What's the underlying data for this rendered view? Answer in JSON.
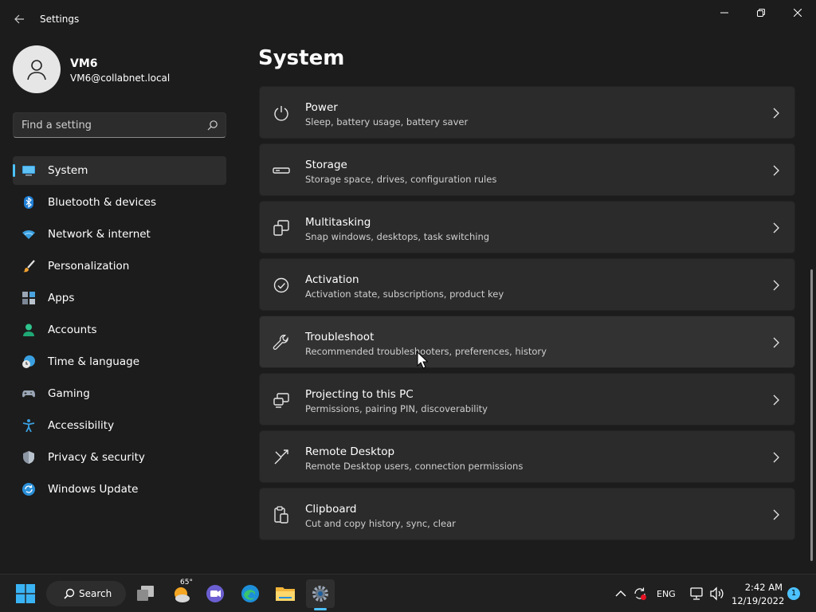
{
  "window": {
    "title": "Settings"
  },
  "user": {
    "name": "VM6",
    "email": "VM6@collabnet.local"
  },
  "search": {
    "placeholder": "Find a setting"
  },
  "nav": [
    {
      "label": "System",
      "icon": "system-icon",
      "active": true
    },
    {
      "label": "Bluetooth & devices",
      "icon": "bluetooth-icon"
    },
    {
      "label": "Network & internet",
      "icon": "wifi-icon"
    },
    {
      "label": "Personalization",
      "icon": "brush-icon"
    },
    {
      "label": "Apps",
      "icon": "apps-icon"
    },
    {
      "label": "Accounts",
      "icon": "accounts-icon"
    },
    {
      "label": "Time & language",
      "icon": "clock-globe-icon"
    },
    {
      "label": "Gaming",
      "icon": "gamepad-icon"
    },
    {
      "label": "Accessibility",
      "icon": "accessibility-icon"
    },
    {
      "label": "Privacy & security",
      "icon": "shield-icon"
    },
    {
      "label": "Windows Update",
      "icon": "update-icon"
    }
  ],
  "main": {
    "title": "System",
    "cards": [
      {
        "title": "Power",
        "subtitle": "Sleep, battery usage, battery saver",
        "icon": "power-icon"
      },
      {
        "title": "Storage",
        "subtitle": "Storage space, drives, configuration rules",
        "icon": "storage-icon"
      },
      {
        "title": "Multitasking",
        "subtitle": "Snap windows, desktops, task switching",
        "icon": "multitasking-icon"
      },
      {
        "title": "Activation",
        "subtitle": "Activation state, subscriptions, product key",
        "icon": "activation-icon"
      },
      {
        "title": "Troubleshoot",
        "subtitle": "Recommended troubleshooters, preferences, history",
        "icon": "wrench-icon",
        "hover": true
      },
      {
        "title": "Projecting to this PC",
        "subtitle": "Permissions, pairing PIN, discoverability",
        "icon": "projecting-icon"
      },
      {
        "title": "Remote Desktop",
        "subtitle": "Remote Desktop users, connection permissions",
        "icon": "remote-desktop-icon"
      },
      {
        "title": "Clipboard",
        "subtitle": "Cut and copy history, sync, clear",
        "icon": "clipboard-icon"
      }
    ]
  },
  "taskbar": {
    "search_label": "Search",
    "weather_temp": "65°",
    "language": "ENG",
    "time": "2:42 AM",
    "date": "12/19/2022",
    "notification_count": "1"
  },
  "colors": {
    "accent": "#4cc2ff",
    "background": "#1c1c1c",
    "card": "#2b2b2b"
  }
}
